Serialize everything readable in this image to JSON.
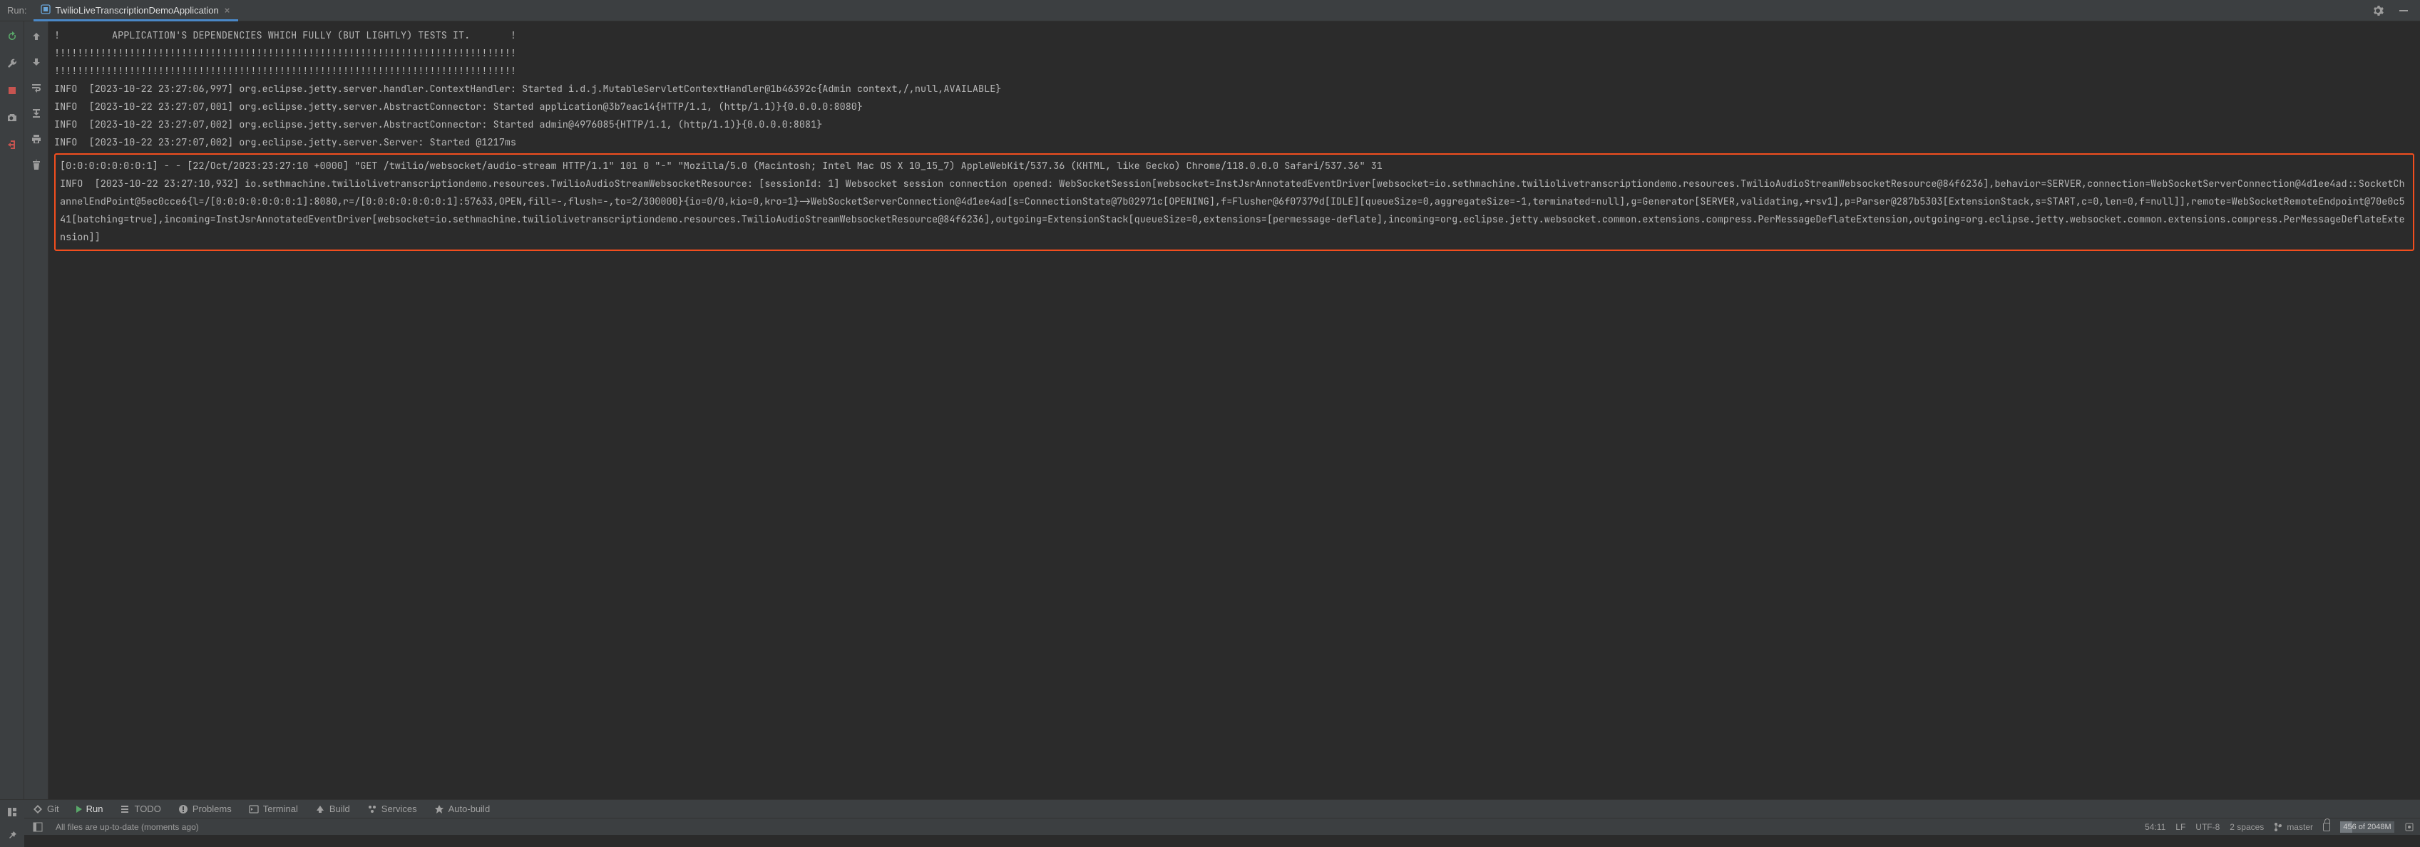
{
  "header": {
    "run_label": "Run:",
    "tab_title": "TwilioLiveTranscriptionDemoApplication"
  },
  "console": {
    "pre_lines": [
      "!         APPLICATION'S DEPENDENCIES WHICH FULLY (BUT LIGHTLY) TESTS IT.       !",
      "!!!!!!!!!!!!!!!!!!!!!!!!!!!!!!!!!!!!!!!!!!!!!!!!!!!!!!!!!!!!!!!!!!!!!!!!!!!!!!!!",
      "!!!!!!!!!!!!!!!!!!!!!!!!!!!!!!!!!!!!!!!!!!!!!!!!!!!!!!!!!!!!!!!!!!!!!!!!!!!!!!!!",
      "INFO  [2023-10-22 23:27:06,997] org.eclipse.jetty.server.handler.ContextHandler: Started i.d.j.MutableServletContextHandler@1b46392c{Admin context,/,null,AVAILABLE}",
      "INFO  [2023-10-22 23:27:07,001] org.eclipse.jetty.server.AbstractConnector: Started application@3b7eac14{HTTP/1.1, (http/1.1)}{0.0.0.0:8080}",
      "INFO  [2023-10-22 23:27:07,002] org.eclipse.jetty.server.AbstractConnector: Started admin@4976085{HTTP/1.1, (http/1.1)}{0.0.0.0:8081}",
      "INFO  [2023-10-22 23:27:07,002] org.eclipse.jetty.server.Server: Started @1217ms"
    ],
    "highlighted_block": "[0:0:0:0:0:0:0:1] - - [22/Oct/2023:23:27:10 +0000] \"GET /twilio/websocket/audio-stream HTTP/1.1\" 101 0 \"-\" \"Mozilla/5.0 (Macintosh; Intel Mac OS X 10_15_7) AppleWebKit/537.36 (KHTML, like Gecko) Chrome/118.0.0.0 Safari/537.36\" 31\nINFO  [2023-10-22 23:27:10,932] io.sethmachine.twiliolivetranscriptiondemo.resources.TwilioAudioStreamWebsocketResource: [sessionId: 1] Websocket session connection opened: WebSocketSession[websocket=InstJsrAnnotatedEventDriver[websocket=io.sethmachine.twiliolivetranscriptiondemo.resources.TwilioAudioStreamWebsocketResource@84f6236],behavior=SERVER,connection=WebSocketServerConnection@4d1ee4ad::SocketChannelEndPoint@5ec0cce6{l=/[0:0:0:0:0:0:0:1]:8080,r=/[0:0:0:0:0:0:0:1]:57633,OPEN,fill=-,flush=-,to=2/300000}{io=0/0,kio=0,kro=1}->WebSocketServerConnection@4d1ee4ad[s=ConnectionState@7b02971c[OPENING],f=Flusher@6f07379d[IDLE][queueSize=0,aggregateSize=-1,terminated=null],g=Generator[SERVER,validating,+rsv1],p=Parser@287b5303[ExtensionStack,s=START,c=0,len=0,f=null]],remote=WebSocketRemoteEndpoint@70e0c541[batching=true],incoming=InstJsrAnnotatedEventDriver[websocket=io.sethmachine.twiliolivetranscriptiondemo.resources.TwilioAudioStreamWebsocketResource@84f6236],outgoing=ExtensionStack[queueSize=0,extensions=[permessage-deflate],incoming=org.eclipse.jetty.websocket.common.extensions.compress.PerMessageDeflateExtension,outgoing=org.eclipse.jetty.websocket.common.extensions.compress.PerMessageDeflateExtension]]"
  },
  "bottom_tools": {
    "git": "Git",
    "run": "Run",
    "todo": "TODO",
    "problems": "Problems",
    "terminal": "Terminal",
    "build": "Build",
    "services": "Services",
    "autobuild": "Auto-build"
  },
  "status": {
    "msg": "All files are up-to-date (moments ago)",
    "caret": "54:11",
    "line_sep": "LF",
    "encoding": "UTF-8",
    "indent": "2 spaces",
    "branch": "master",
    "mem": "456 of 2048M",
    "mem_pct": 22
  }
}
